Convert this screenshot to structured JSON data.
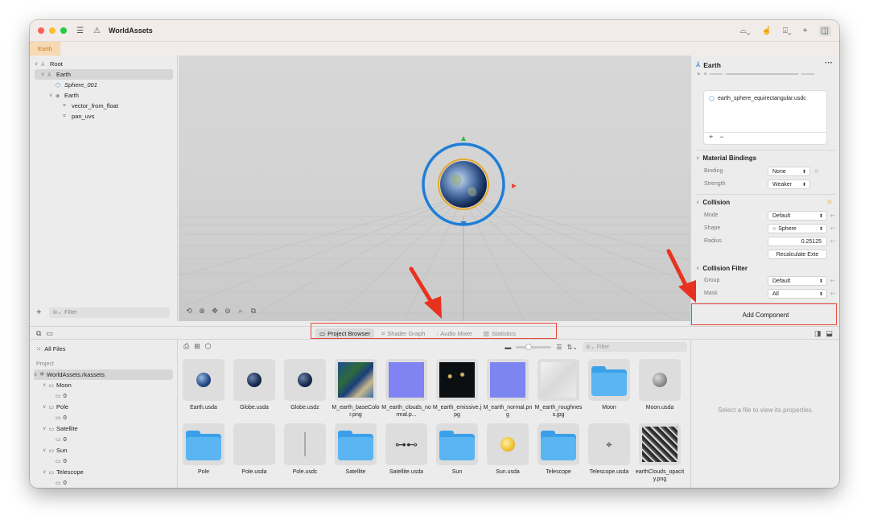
{
  "window": {
    "title": "WorldAssets",
    "doc_tab": "Earth"
  },
  "hierarchy": {
    "items": [
      {
        "label": "Root"
      },
      {
        "label": "Earth"
      },
      {
        "label": "Sphere_001"
      },
      {
        "label": "Earth"
      },
      {
        "label": "vector_from_float"
      },
      {
        "label": "pan_uvs"
      }
    ],
    "filter_placeholder": "Filter"
  },
  "inspector": {
    "title": "Earth",
    "references": {
      "item": "earth_sphere_equirectangular.usdc",
      "add": "+",
      "remove": "−"
    },
    "material_bindings": {
      "title": "Material Bindings",
      "binding_label": "Binding",
      "binding_value": "None",
      "strength_label": "Strength",
      "strength_value": "Weaker"
    },
    "collision": {
      "title": "Collision",
      "mode_label": "Mode",
      "mode_value": "Default",
      "shape_label": "Shape",
      "shape_value": "Sphere",
      "radius_label": "Radius",
      "radius_value": "0.25125",
      "recalc_button": "Recalculate Exte"
    },
    "collision_filter": {
      "title": "Collision Filter",
      "group_label": "Group",
      "group_value": "Default",
      "mask_label": "Mask",
      "mask_value": "All"
    },
    "add_component": "Add Component"
  },
  "bottom_tabs": [
    {
      "label": "Project Browser"
    },
    {
      "label": "Shader Graph"
    },
    {
      "label": "Audio Mixer"
    },
    {
      "label": "Statistics"
    }
  ],
  "project": {
    "all_files": "All Files",
    "section": "Project",
    "root": "WorldAssets.rkassets",
    "tree": [
      {
        "label": "Moon",
        "child": "0"
      },
      {
        "label": "Pole",
        "child": "0"
      },
      {
        "label": "Satellite",
        "child": "0"
      },
      {
        "label": "Sun",
        "child": "0"
      },
      {
        "label": "Telescope",
        "child": "0"
      }
    ],
    "filter_placeholder": "Filter",
    "assets": [
      {
        "name": "Earth.usda",
        "icon": "earth-model-icon"
      },
      {
        "name": "Globe.usda",
        "icon": "globe-model-icon"
      },
      {
        "name": "Globe.usdz",
        "icon": "globe-model-icon"
      },
      {
        "name": "M_earth_baseColor.png",
        "icon": "earth-texture-icon"
      },
      {
        "name": "M_earth_clouds_normal.p...",
        "icon": "normal-map-icon"
      },
      {
        "name": "M_earth_emissive.jpg",
        "icon": "night-texture-icon"
      },
      {
        "name": "M_earth_normal.png",
        "icon": "normal-map-icon"
      },
      {
        "name": "M_earth_roughness.jpg",
        "icon": "roughness-texture-icon"
      },
      {
        "name": "Moon",
        "icon": "folder-icon"
      },
      {
        "name": "Moon.usda",
        "icon": "moon-model-icon"
      },
      {
        "name": "Pole",
        "icon": "folder-icon"
      },
      {
        "name": "Pole.usda",
        "icon": "empty-model-icon"
      },
      {
        "name": "Pole.usdc",
        "icon": "pole-model-icon"
      },
      {
        "name": "Satellite",
        "icon": "folder-icon"
      },
      {
        "name": "Satellite.usda",
        "icon": "satellite-model-icon"
      },
      {
        "name": "Sun",
        "icon": "folder-icon"
      },
      {
        "name": "Sun.usda",
        "icon": "sun-model-icon"
      },
      {
        "name": "Telescope",
        "icon": "folder-icon"
      },
      {
        "name": "Telescope.usda",
        "icon": "telescope-model-icon"
      },
      {
        "name": "earthClouds_opacity.png",
        "icon": "clouds-texture-icon"
      }
    ],
    "detail_message": "Select a file to view its properties."
  },
  "colors": {
    "accent_tab": "#f7d9b3",
    "gizmo_blue": "#1f7fd6",
    "callout_red": "#e8473a",
    "folder_blue": "#3ba0ea"
  }
}
